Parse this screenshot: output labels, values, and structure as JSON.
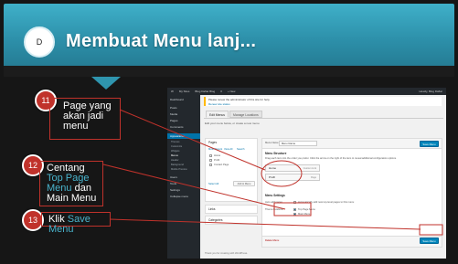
{
  "slide": {
    "badge": "D",
    "title": "Membuat Menu lanj..."
  },
  "colors": {
    "banner": "#2c8ea8",
    "callout_border": "#c0322b",
    "highlight_text": "#49b3cc",
    "wp_sidebar": "#23282d",
    "wp_primary": "#0085ba"
  },
  "steps": [
    {
      "number": "11",
      "text": "Page yang akan jadi menu"
    },
    {
      "number": "12",
      "text_pre": "Centang ",
      "text_hl": "Top Page Menu",
      "text_mid": " dan Main Menu"
    },
    {
      "number": "13",
      "text_pre": "Klik ",
      "text_hl": "Save Menu"
    }
  ],
  "wp": {
    "topbar": [
      "W",
      "My Sites",
      "Blog Daftar Blog",
      "0",
      "+ New",
      "Howdy, Blog Daftar"
    ],
    "sidebar": [
      {
        "label": "Dashboard"
      },
      {
        "label": "Posts"
      },
      {
        "label": "Media"
      },
      {
        "label": "Pages"
      },
      {
        "label": "Comments"
      },
      {
        "label": "Appearance",
        "active": true
      }
    ],
    "sidebar_sub": [
      "Themes",
      "Customize",
      "Widgets",
      "Menus",
      "Header",
      "Background",
      "Mobile Preview"
    ],
    "sidebar_lower": [
      "Users",
      "Tools",
      "Settings",
      "Collapse menu"
    ],
    "notice_line1": "Please renew the administrator of this site for help.",
    "notice_line2": "Renew site status",
    "tabs": [
      "Edit Menus",
      "Manage Locations"
    ],
    "edit_line": "Edit your menu below, or create a new menu.",
    "pages_box": {
      "title": "Pages",
      "subtabs": [
        "Most Recent",
        "View All",
        "Search"
      ],
      "items": [
        "Home",
        "Profil",
        "Contact Page"
      ],
      "select_all": "Select All",
      "add_button": "Add to Menu"
    },
    "links_box": {
      "title": "Links"
    },
    "categories_box": {
      "title": "Categories"
    },
    "menu_name_label": "Menu Name",
    "menu_name_value": "Menu Utama",
    "save_button_top": "Save Menu",
    "structure_title": "Menu Structure",
    "structure_hint": "Drag each item into the order you prefer. Click the arrow on the right of the item to reveal additional configuration options.",
    "menu_items": [
      {
        "label": "Home",
        "type": "Custom Link"
      },
      {
        "label": "Profil",
        "type": "Page"
      }
    ],
    "settings_title": "Menu Settings",
    "auto_add_label": "Auto add pages",
    "auto_add_text": "Automatically add new top-level pages to this menu",
    "theme_locations_label": "Theme locations",
    "locations": [
      {
        "label": "Top Page Menu",
        "checked": true
      },
      {
        "label": "Main Menu",
        "checked": true
      }
    ],
    "delete_link": "Delete Menu",
    "save_button_bottom": "Save Menu",
    "footer": "Thank you for creating with WordPress."
  }
}
